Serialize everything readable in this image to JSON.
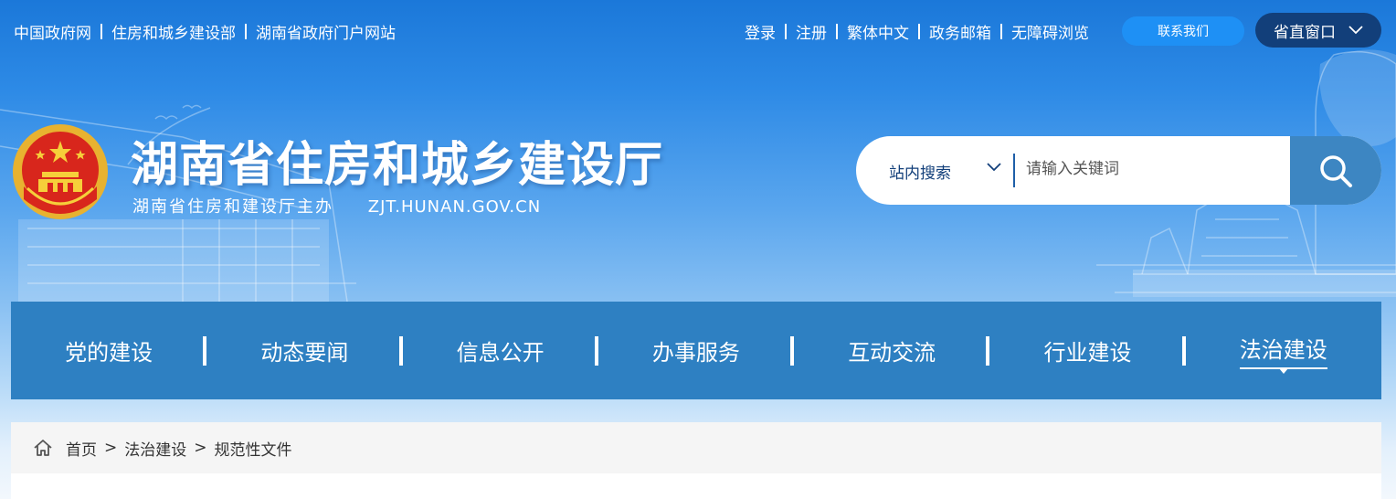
{
  "topbar": {
    "left_links": [
      "中国政府网",
      "住房和城乡建设部",
      "湖南省政府门户网站"
    ],
    "right_links": [
      "登录",
      "注册",
      "繁体中文",
      "政务邮箱",
      "无障碍浏览"
    ],
    "contact_button": "联系我们",
    "province_button": "省直窗口"
  },
  "site": {
    "title": "湖南省住房和城乡建设厅",
    "subtitle": "湖南省住房和建设厅主办",
    "domain": "ZJT.HUNAN.GOV.CN"
  },
  "search": {
    "scope": "站内搜索",
    "placeholder": "请输入关键词"
  },
  "nav": {
    "items": [
      "党的建设",
      "动态要闻",
      "信息公开",
      "办事服务",
      "互动交流",
      "行业建设",
      "法治建设"
    ],
    "active_index": 6
  },
  "breadcrumb": {
    "items": [
      "首页",
      "法治建设",
      "规范性文件"
    ]
  },
  "colors": {
    "nav_bg": "#2e80c2",
    "province_btn": "#123f7a",
    "contact_btn": "#1e90f5",
    "search_btn": "#3d86c2"
  }
}
